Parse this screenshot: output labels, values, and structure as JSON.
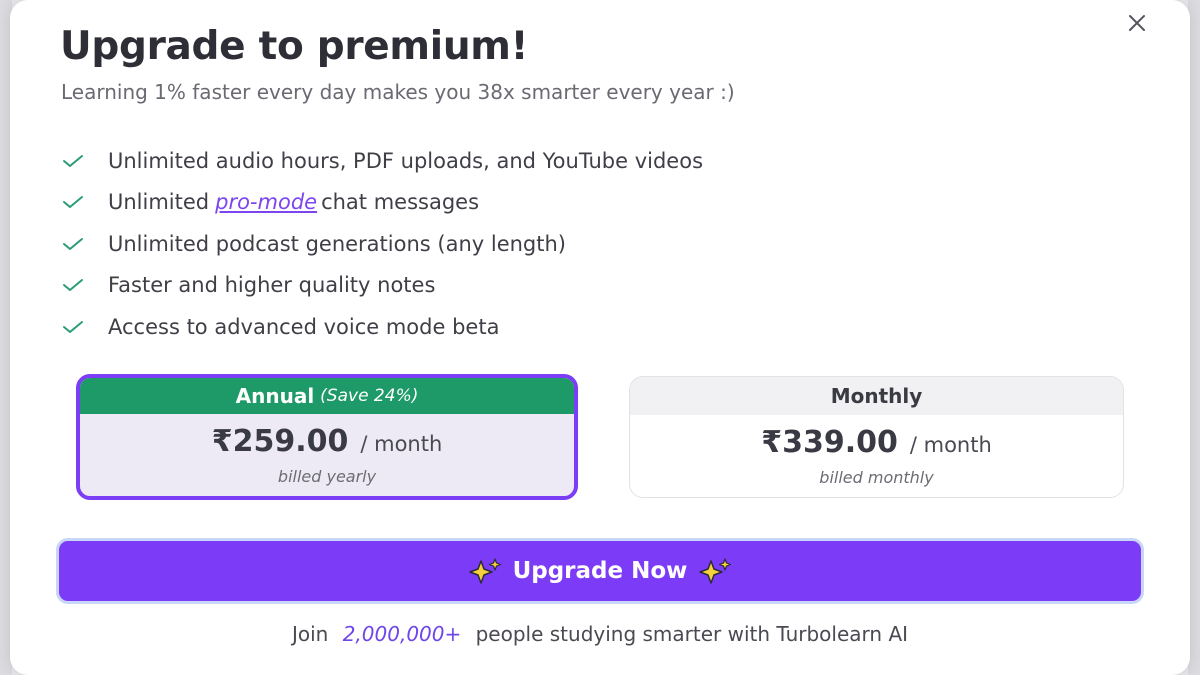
{
  "modal": {
    "title": "Upgrade to premium!",
    "subtitle": "Learning 1% faster every day makes you 38x smarter every year :)"
  },
  "features": {
    "item1": "Unlimited audio hours, PDF uploads, and YouTube videos",
    "item2_prefix": "Unlimited",
    "item2_link": "pro-mode",
    "item2_suffix": "chat messages",
    "item3": "Unlimited podcast generations (any length)",
    "item4": "Faster and higher quality notes",
    "item5": "Access to advanced voice mode beta"
  },
  "plans": {
    "annual": {
      "name": "Annual",
      "save": "(Save 24%)",
      "price": "₹259.00",
      "per": "/ month",
      "billed": "billed yearly",
      "selected": true
    },
    "monthly": {
      "name": "Monthly",
      "price": "₹339.00",
      "per": "/ month",
      "billed": "billed monthly",
      "selected": false
    }
  },
  "cta": {
    "label": "Upgrade Now"
  },
  "footer": {
    "prefix": "Join",
    "count": "2,000,000+",
    "suffix": "people studying smarter with Turbolearn AI"
  },
  "icons": {
    "close": "close-icon",
    "check": "check-icon",
    "sparkle": "sparkles-icon"
  },
  "colors": {
    "accent": "#7c3cf7",
    "annual_header": "#1e9a68",
    "check": "#2a9d78",
    "link": "#7b45f0"
  }
}
